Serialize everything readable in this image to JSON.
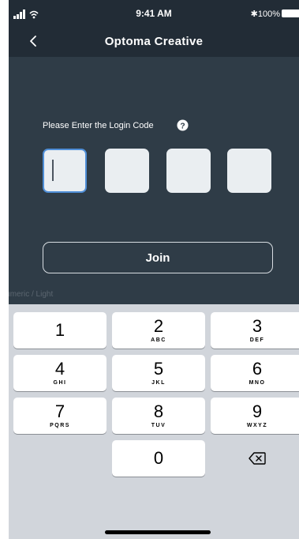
{
  "status_bar": {
    "time": "9:41 AM",
    "battery": "100%"
  },
  "nav": {
    "title": "Optoma Creative",
    "back_icon": "chevron-left-icon"
  },
  "login": {
    "prompt": "Please Enter the Login Code",
    "help_icon": "question-circle-icon",
    "code_digits": [
      "",
      "",
      "",
      ""
    ],
    "active_index": 0,
    "join_label": "Join"
  },
  "keyboard": {
    "label": "Numeric / Light",
    "keys": [
      {
        "num": "1",
        "letters": ""
      },
      {
        "num": "2",
        "letters": "ABC"
      },
      {
        "num": "3",
        "letters": "DEF"
      },
      {
        "num": "4",
        "letters": "GHI"
      },
      {
        "num": "5",
        "letters": "JKL"
      },
      {
        "num": "6",
        "letters": "MNO"
      },
      {
        "num": "7",
        "letters": "PQRS"
      },
      {
        "num": "8",
        "letters": "TUV"
      },
      {
        "num": "9",
        "letters": "WXYZ"
      },
      {
        "num": "0",
        "letters": ""
      }
    ],
    "delete_icon": "backspace-icon"
  },
  "colors": {
    "background": "#2f3c47",
    "bar": "#222c36",
    "accent": "#4f8ed7",
    "keyboard": "#d1d5db"
  }
}
